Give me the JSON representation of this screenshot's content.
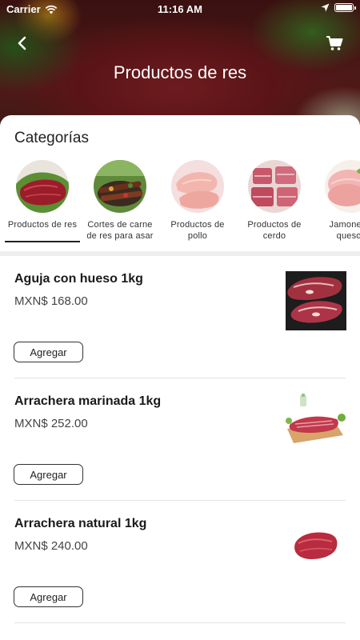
{
  "status_bar": {
    "carrier": "Carrier",
    "time": "11:16 AM",
    "icons": [
      "wifi-icon",
      "location-arrow-icon",
      "battery-icon"
    ]
  },
  "header": {
    "title": "Productos de res",
    "back_icon": "chevron-left-icon",
    "cart_icon": "cart-icon"
  },
  "categories": {
    "heading": "Categorías",
    "selected_index": 0,
    "items": [
      {
        "label": "Productos de res",
        "image": "raw-beef-steak"
      },
      {
        "label": "Cortes de carne de res para asar",
        "image": "grilled-meat-skewers"
      },
      {
        "label": "Productos de pollo",
        "image": "raw-chicken-breasts"
      },
      {
        "label": "Productos de cerdo",
        "image": "raw-pork-cuts"
      },
      {
        "label": "Jamones y quesos",
        "image": "ham-and-cheese-slices"
      }
    ]
  },
  "products": [
    {
      "name": "Aguja con hueso 1kg",
      "price": "MXN$ 168.00",
      "button": "Agregar",
      "image": "bone-in-chuck-steaks"
    },
    {
      "name": "Arrachera marinada 1kg",
      "price": "MXN$ 252.00",
      "button": "Agregar",
      "image": "marinated-skirt-steak-on-board"
    },
    {
      "name": "Arrachera natural 1kg",
      "price": "MXN$ 240.00",
      "button": "Agregar",
      "image": "raw-skirt-steak"
    }
  ],
  "colors": {
    "text_primary": "#1a1a1a",
    "text_secondary": "#444444",
    "header_text": "#ffffff",
    "divider": "#eeeeee"
  }
}
